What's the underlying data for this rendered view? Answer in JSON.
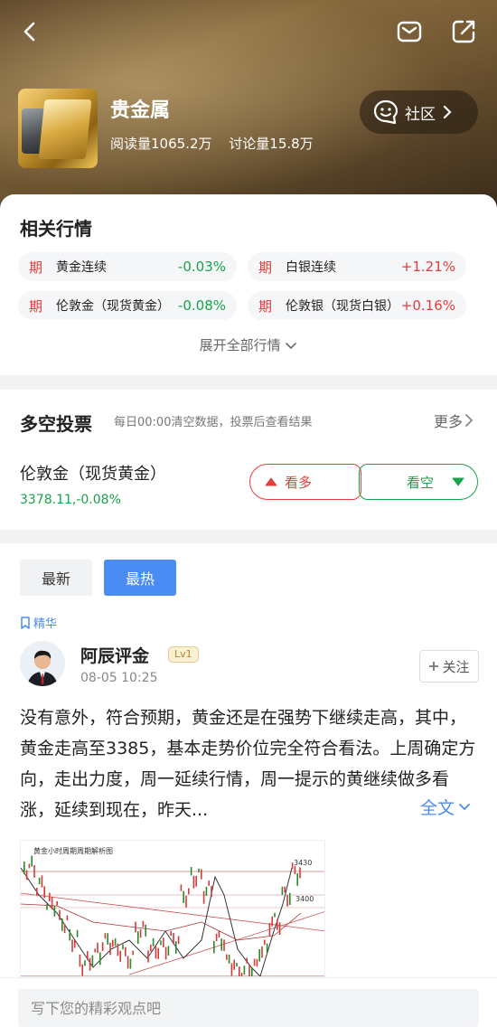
{
  "header": {
    "topic_title": "贵金属",
    "read_count": "阅读量1065.2万",
    "discuss_count": "讨论量15.8万",
    "community_label": "社区"
  },
  "market": {
    "title": "相关行情",
    "quotes": [
      {
        "tag": "期",
        "name": "黄金连续",
        "change": "-0.03%",
        "direction": "down"
      },
      {
        "tag": "期",
        "name": "白银连续",
        "change": "+1.21%",
        "direction": "up"
      },
      {
        "tag": "期",
        "name": "伦敦金（现货黄金）",
        "change": "-0.08%",
        "direction": "down"
      },
      {
        "tag": "期",
        "name": "伦敦银（现货白银）",
        "change": "+0.16%",
        "direction": "up"
      }
    ],
    "expand_label": "展开全部行情"
  },
  "vote": {
    "title": "多空投票",
    "subtitle": "每日00:00清空数据，投票后查看结果",
    "more_label": "更多",
    "asset_name": "伦敦金（现货黄金）",
    "asset_price": "3378.11,-0.08%",
    "bull_label": "看多",
    "bear_label": "看空"
  },
  "feed": {
    "tabs": [
      {
        "label": "最新"
      },
      {
        "label": "最热"
      }
    ],
    "active_tab": "最热",
    "featured_label": "精华",
    "post": {
      "author": "阿辰评金",
      "level": "Lv1",
      "time": "08-05 10:25",
      "follow_label": "关注",
      "text": "没有意外，符合预期，黄金还是在强势下继续走高，其中，黄金走高至3385，基本走势价位完全符合看法。上周确定方向，走出力度，周一延续行情，周一提示的黄继续做多看涨，延续到现在，昨天...",
      "full_text_label": "全文",
      "image_caption": "黄金小时周期周期解析图",
      "image_labels": {
        "high": "3430",
        "mid": "3400"
      }
    }
  },
  "comment": {
    "placeholder": "写下您的精彩观点吧"
  },
  "colors": {
    "up": "#e53c3c",
    "down": "#17a34a",
    "accent": "#4b8bf4"
  }
}
